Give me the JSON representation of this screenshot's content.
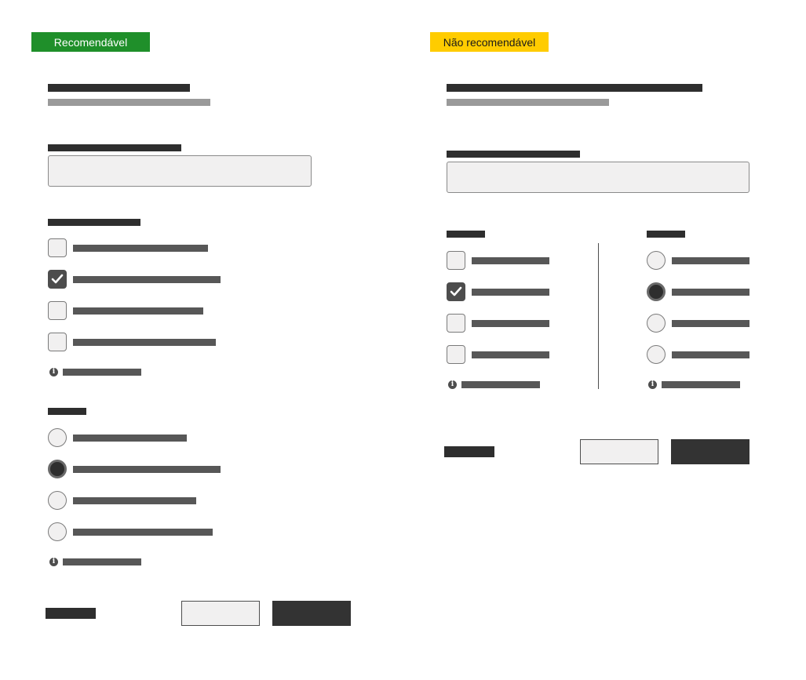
{
  "recommended": {
    "badge_label": "Recomendável",
    "badge_color": "#1f8f2a"
  },
  "not_recommended": {
    "badge_label": "Não recomendável",
    "badge_color": "#ffcc00"
  },
  "colors": {
    "placeholder_dark": "#2e2e2e",
    "placeholder_mid": "#575757",
    "placeholder_light": "#9a9a9a",
    "field_fill": "#f1f0f0",
    "primary_button": "#333333"
  },
  "icons": {
    "checkmark": "check-icon",
    "info": "info-icon"
  },
  "checkbox_states": {
    "recommended": [
      false,
      true,
      false,
      false
    ],
    "not_recommended": [
      false,
      true,
      false,
      false
    ]
  },
  "radio_states": {
    "recommended": [
      false,
      true,
      false,
      false
    ],
    "not_recommended": [
      false,
      true,
      false,
      false
    ]
  }
}
